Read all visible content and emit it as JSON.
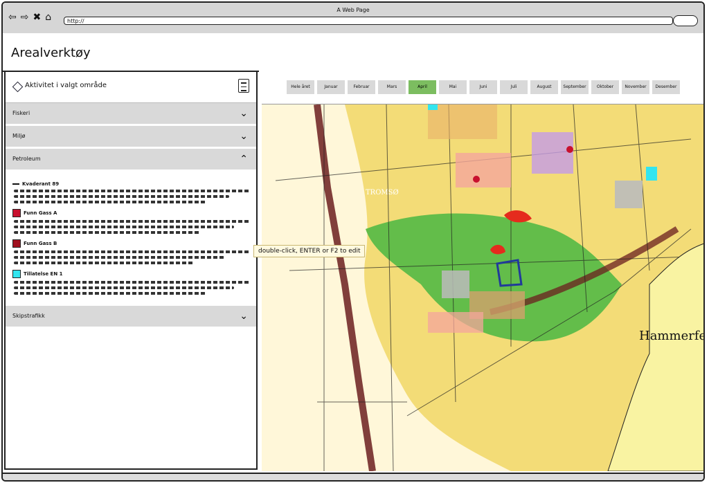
{
  "browser": {
    "title": "A Web Page",
    "url": "http://"
  },
  "app": {
    "title": "Arealverktøy"
  },
  "panel": {
    "header": "Aktivitet i valgt område"
  },
  "accordion": [
    {
      "label": "Fiskeri"
    },
    {
      "label": "Miljø"
    },
    {
      "label": "Petroleum"
    },
    {
      "label": "Skipstrafikk"
    }
  ],
  "petroleum_items": [
    {
      "label": "Kvaderant 89",
      "color": "#111111"
    },
    {
      "label": "Funn Gass A",
      "color": "#c8102e"
    },
    {
      "label": "Funn Gass B",
      "color": "#a0101f"
    },
    {
      "label": "Tillatelse EN 1",
      "color": "#33e5ef"
    }
  ],
  "months": [
    "Hele året",
    "Januar",
    "Februar",
    "Mars",
    "April",
    "Mai",
    "Juni",
    "Juli",
    "August",
    "September",
    "Oktober",
    "November",
    "Desember"
  ],
  "active_month": "April",
  "map": {
    "place_labels": [
      "Hammerfest",
      "TROMSØ"
    ]
  },
  "tooltip": "double-click, ENTER or F2 to edit"
}
